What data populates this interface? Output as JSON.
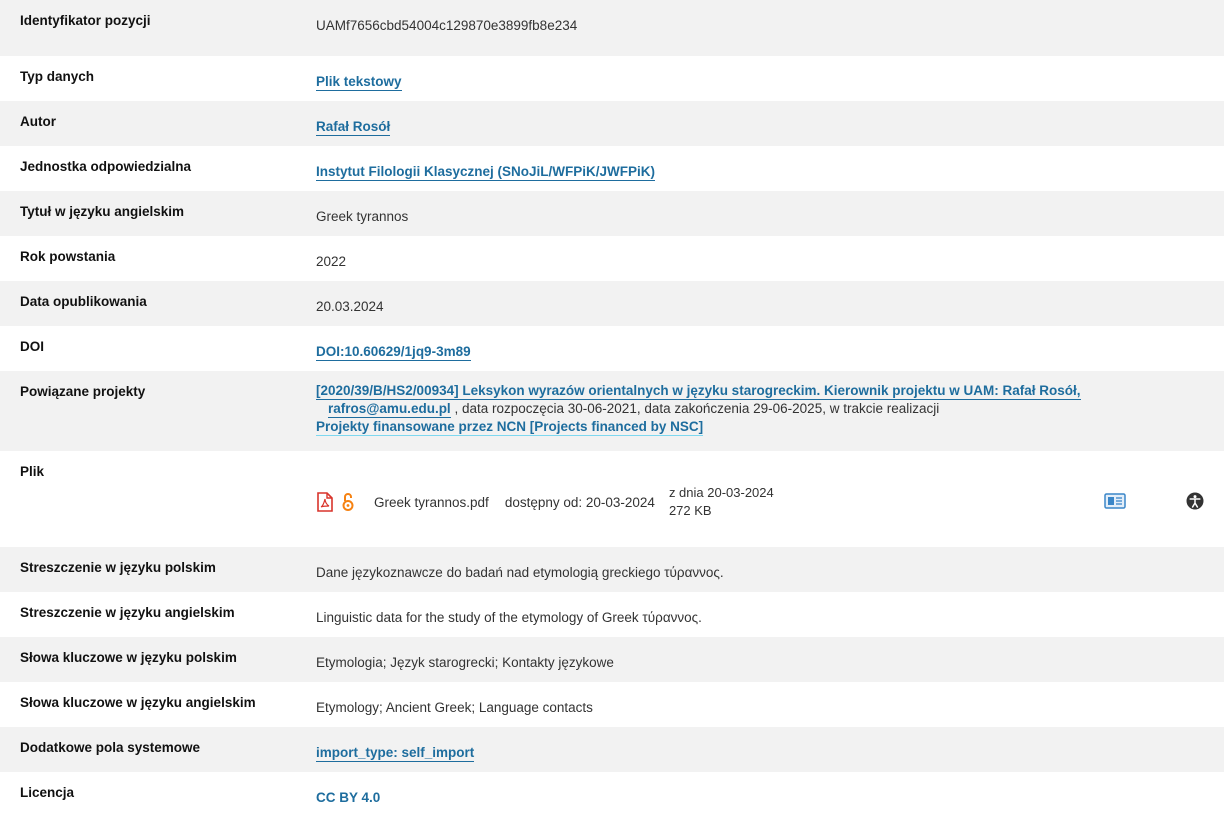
{
  "rows": {
    "id": {
      "label": "Identyfikator pozycji",
      "value": "UAMf7656cbd54004c129870e3899fb8e234"
    },
    "type": {
      "label": "Typ danych",
      "value": "Plik tekstowy"
    },
    "author": {
      "label": "Autor",
      "value": "Rafał Rosół"
    },
    "unit": {
      "label": "Jednostka odpowiedzialna",
      "value": "Instytut Filologii Klasycznej (SNoJiL/WFPiK/JWFPiK)"
    },
    "title_en": {
      "label": "Tytuł w języku angielskim",
      "value": "Greek tyrannos"
    },
    "year": {
      "label": "Rok powstania",
      "value": "2022"
    },
    "published": {
      "label": "Data opublikowania",
      "value": "20.03.2024"
    },
    "doi": {
      "label": "DOI",
      "value": "DOI:10.60629/1jq9-3m89"
    },
    "projects": {
      "label": "Powiązane projekty",
      "project_link": "[2020/39/B/HS2/00934] Leksykon wyrazów orientalnych w języku starogreckim. Kierownik projektu w UAM: Rafał Rosół,",
      "email": "rafros@amu.edu.pl",
      "project_details": ", data rozpoczęcia 30-06-2021, data zakończenia 29-06-2025, w trakcie realizacji",
      "funding_link": "Projekty finansowane przez NCN [Projects financed by NSC]"
    },
    "file": {
      "label": "Plik",
      "name": "Greek tyrannos.pdf",
      "available": "dostępny od: 20-03-2024",
      "date": "z dnia 20-03-2024",
      "size": "272 KB",
      "icons": [
        "pdf-icon",
        "open-access-icon",
        "preview-card-icon",
        "accessibility-icon"
      ]
    },
    "abstract_pl": {
      "label": "Streszczenie w języku polskim",
      "value": "Dane językoznawcze do badań nad etymologią greckiego τύραννος."
    },
    "abstract_en": {
      "label": "Streszczenie w języku angielskim",
      "value": "Linguistic data for the study of the etymology of Greek τύραννος."
    },
    "keywords_pl": {
      "label": "Słowa kluczowe w języku polskim",
      "value": "Etymologia; Język starogrecki; Kontakty językowe"
    },
    "keywords_en": {
      "label": "Słowa kluczowe w języku angielskim",
      "value": "Etymology; Ancient Greek; Language contacts"
    },
    "system": {
      "label": "Dodatkowe pola systemowe",
      "value": "import_type: self_import"
    },
    "license": {
      "label": "Licencja",
      "value": "CC BY 4.0"
    }
  },
  "colors": {
    "link": "#1e6d9e",
    "row_shade": "#f2f2f2",
    "pdf": "#d9342b",
    "open_access": "#f68212",
    "preview_icon": "#3a86c8"
  }
}
